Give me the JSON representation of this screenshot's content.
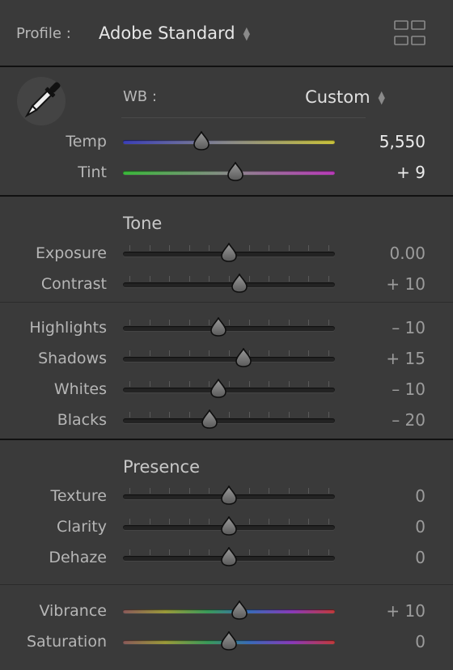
{
  "profile": {
    "label": "Profile :",
    "value": "Adobe Standard",
    "browse_icon": "grid-icon"
  },
  "wb": {
    "label": "WB :",
    "value": "Custom",
    "picker_icon": "eyedropper-icon"
  },
  "sections": {
    "tone": "Tone",
    "presence": "Presence"
  },
  "sliders": [
    {
      "id": "temp",
      "label": "Temp",
      "value": "5,550",
      "pos": 0.37
    },
    {
      "id": "tint",
      "label": "Tint",
      "value": "+ 9",
      "pos": 0.53
    },
    {
      "id": "exposure",
      "label": "Exposure",
      "value": "0.00",
      "pos": 0.5
    },
    {
      "id": "contrast",
      "label": "Contrast",
      "value": "+ 10",
      "pos": 0.55
    },
    {
      "id": "highlights",
      "label": "Highlights",
      "value": "– 10",
      "pos": 0.45
    },
    {
      "id": "shadows",
      "label": "Shadows",
      "value": "+ 15",
      "pos": 0.57
    },
    {
      "id": "whites",
      "label": "Whites",
      "value": "– 10",
      "pos": 0.45
    },
    {
      "id": "blacks",
      "label": "Blacks",
      "value": "– 20",
      "pos": 0.41
    },
    {
      "id": "texture",
      "label": "Texture",
      "value": "0",
      "pos": 0.5
    },
    {
      "id": "clarity",
      "label": "Clarity",
      "value": "0",
      "pos": 0.5
    },
    {
      "id": "dehaze",
      "label": "Dehaze",
      "value": "0",
      "pos": 0.5
    },
    {
      "id": "vibrance",
      "label": "Vibrance",
      "value": "+ 10",
      "pos": 0.55
    },
    {
      "id": "saturation",
      "label": "Saturation",
      "value": "0",
      "pos": 0.5
    }
  ],
  "colors": {
    "panel_bg": "#3a3a3a",
    "temp_gradient": [
      "#3b3fb8",
      "#8a8a8a",
      "#c9c23a"
    ],
    "tint_gradient": [
      "#3ab83a",
      "#8a8a8a",
      "#b83ab8"
    ],
    "vibrance_gradient": [
      "#8a5a5a",
      "#9a9a3a",
      "#3a9a5a",
      "#3a6ab8",
      "#8a3ab8",
      "#c23a3a"
    ]
  }
}
